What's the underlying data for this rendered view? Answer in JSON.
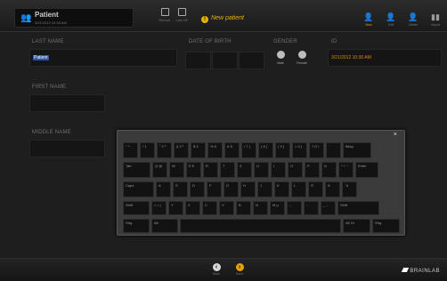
{
  "header": {
    "patient_title": "Patient",
    "patient_sub": "3/21/2012 10:30 AM",
    "toolbar_buttons": [
      {
        "label": "Remove"
      },
      {
        "label": "Lock Off"
      }
    ],
    "status": "New patient",
    "right_buttons": [
      {
        "label": "New",
        "icon": "add-patient-icon"
      },
      {
        "label": "Edit",
        "icon": "edit-patient-icon"
      },
      {
        "label": "Delete",
        "icon": "delete-patient-icon"
      },
      {
        "label": "Import",
        "icon": "import-icon"
      }
    ]
  },
  "form": {
    "last_name_label": "Last name",
    "last_name_value": "Patient",
    "dob_label": "Date of birth",
    "gender_label": "Gender",
    "gender_options": [
      {
        "label": "Male"
      },
      {
        "label": "Female"
      }
    ],
    "id_label": "ID",
    "id_value": "3/21/2012 10:30 AM",
    "first_name_label": "First name",
    "middle_name_label": "Middle name"
  },
  "keyboard": {
    "close_glyph": "×",
    "rows": [
      [
        "° ^",
        "! 1",
        "\" 2 ²",
        "§ 3 ³",
        "$ 4",
        "% 5",
        "& 6",
        "/ 7 {",
        "( 8 [",
        ") 9 ]",
        "= 0 }",
        "? ß \\",
        "` ´",
        "Bksp"
      ],
      [
        "Tab",
        "Q @",
        "W",
        "E €",
        "R",
        "T",
        "Z",
        "U",
        "I",
        "O",
        "P",
        "Ü",
        "* + ~",
        "Enter"
      ],
      [
        "Caps",
        "A",
        "S",
        "D",
        "F",
        "G",
        "H",
        "J",
        "K",
        "L",
        "Ö",
        "Ä",
        "' #"
      ],
      [
        "Shift",
        "> < |",
        "Y",
        "X",
        "C",
        "V",
        "B",
        "N",
        "M µ",
        "; ,",
        ": .",
        "_ -",
        "Shift"
      ],
      [
        "Strg",
        "Alt",
        "",
        "Alt Gr",
        "Strg"
      ]
    ]
  },
  "footer": {
    "back_label": "Back",
    "done_label": "Done",
    "brand": "BRAINLAB"
  },
  "colors": {
    "accent": "#e6a000",
    "id_text": "#e08a1a",
    "selection": "#2d52a8"
  }
}
